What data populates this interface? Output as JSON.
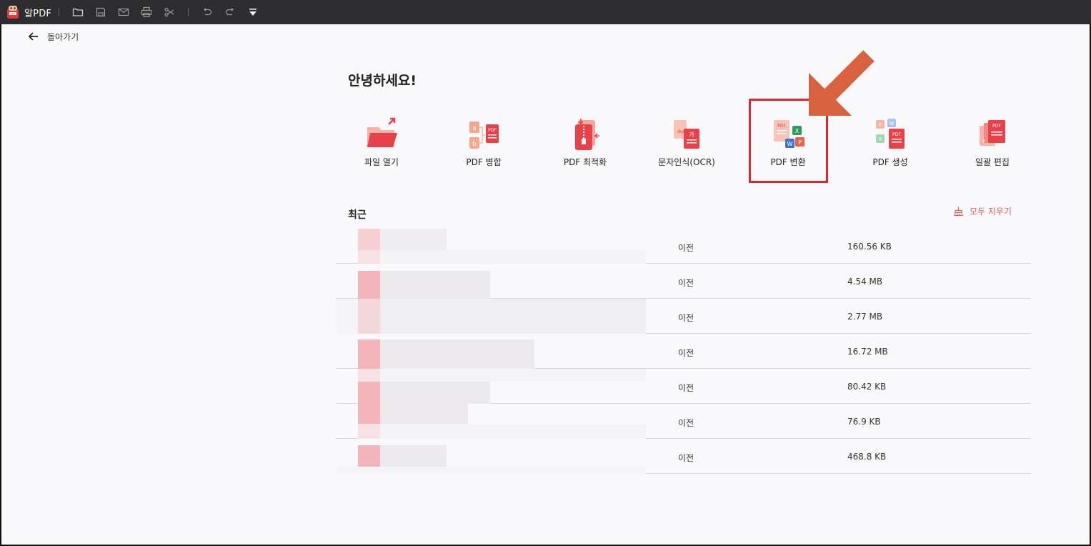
{
  "app": {
    "brand_name": "알PDF"
  },
  "toolbar": {
    "icons": [
      "folder-icon",
      "save-icon",
      "mail-icon",
      "print-icon",
      "scissors-icon",
      "undo-icon",
      "redo-icon",
      "dropdown-icon"
    ]
  },
  "nav": {
    "back_label": "돌아가기"
  },
  "home": {
    "greeting": "안녕하세요!",
    "tools": [
      {
        "label": "파일 열기",
        "icon": "folder-open-icon"
      },
      {
        "label": "PDF 병합",
        "icon": "merge-icon"
      },
      {
        "label": "PDF 최적화",
        "icon": "zip-icon"
      },
      {
        "label": "문자인식(OCR)",
        "icon": "ocr-icon"
      },
      {
        "label": "PDF 변환",
        "icon": "convert-icon"
      },
      {
        "label": "PDF 생성",
        "icon": "create-icon"
      },
      {
        "label": "일괄 편집",
        "icon": "batch-edit-icon"
      }
    ]
  },
  "recent": {
    "title": "최근",
    "clear_label": "모두 지우기",
    "rows": [
      {
        "when": "이전",
        "size": "160.56 KB"
      },
      {
        "when": "이전",
        "size": "4.54 MB"
      },
      {
        "when": "이전",
        "size": "2.77 MB"
      },
      {
        "when": "이전",
        "size": "16.72 MB"
      },
      {
        "when": "이전",
        "size": "80.42 KB"
      },
      {
        "when": "이전",
        "size": "76.9 KB"
      },
      {
        "when": "이전",
        "size": "468.8 KB"
      }
    ]
  },
  "colors": {
    "accent": "#e0262d",
    "arrow": "#d9623e",
    "toolbar_bg": "#2d2d30"
  }
}
